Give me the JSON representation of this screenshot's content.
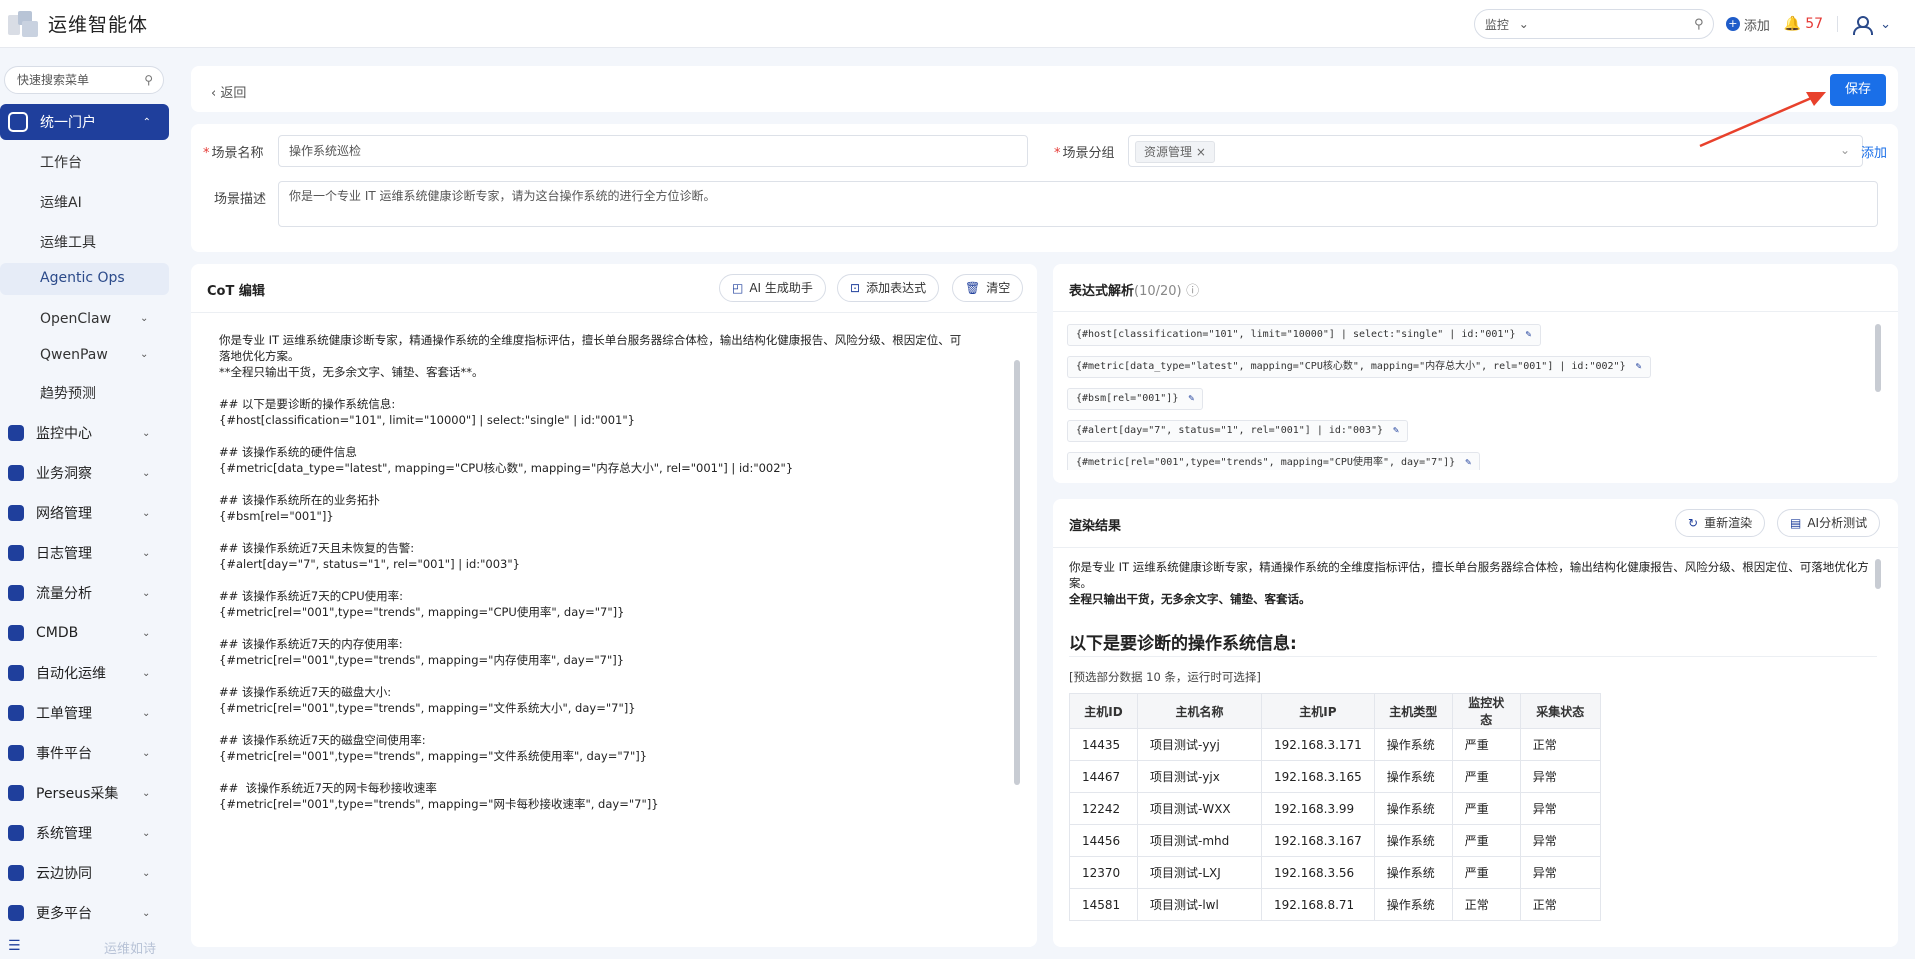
{
  "header": {
    "title": "运维智能体",
    "search_scope": "监控",
    "add_label": "添加",
    "alert_count": "57"
  },
  "sidebar": {
    "search_placeholder": "快速搜索菜单",
    "active_menu": "统一门户",
    "sub_items": [
      "工作台",
      "运维AI",
      "运维工具"
    ],
    "selected_sub": "Agentic Ops",
    "sub_groups": [
      "OpenClaw",
      "QwenPaw"
    ],
    "sub_tail": "趋势预测",
    "menus": [
      "监控中心",
      "业务洞察",
      "网络管理",
      "日志管理",
      "流量分析",
      "CMDB",
      "自动化运维",
      "工单管理",
      "事件平台",
      "Perseus采集",
      "系统管理",
      "云边协同",
      "更多平台"
    ],
    "footer_quote": "运维如诗"
  },
  "topcard": {
    "back_label": "返回",
    "save_label": "保存"
  },
  "form": {
    "name_label": "场景名称",
    "name_value": "操作系统巡检",
    "group_label": "场景分组",
    "group_tag": "资源管理",
    "group_add": "添加",
    "desc_label": "场景描述",
    "desc_value": "你是一个专业 IT 运维系统健康诊断专家，请为这台操作系统的进行全方位诊断。"
  },
  "cot": {
    "title": "CoT 编辑",
    "btn_ai": "AI 生成助手",
    "btn_expr": "添加表达式",
    "btn_clear": "清空",
    "lines": [
      "你是专业 IT 运维系统健康诊断专家，精通操作系统的全维度指标评估，擅长单台服务器综合体检，输出结构化健康报告、风险分级、根因定位、可",
      "落地优化方案。",
      "**全程只输出干货，无多余文字、铺垫、客套话**。",
      "",
      "## 以下是要诊断的操作系统信息:",
      "{#host[classification=\"101\", limit=\"10000\"] | select:\"single\" | id:\"001\"}",
      "",
      "## 该操作系统的硬件信息",
      "{#metric[data_type=\"latest\", mapping=\"CPU核心数\", mapping=\"内存总大小\", rel=\"001\"] | id:\"002\"}",
      "",
      "## 该操作系统所在的业务拓扑",
      "{#bsm[rel=\"001\"]}",
      "",
      "## 该操作系统近7天且未恢复的告警:",
      "{#alert[day=\"7\", status=\"1\", rel=\"001\"] | id:\"003\"}",
      "",
      "## 该操作系统近7天的CPU使用率:",
      "{#metric[rel=\"001\",type=\"trends\", mapping=\"CPU使用率\", day=\"7\"]}",
      "",
      "## 该操作系统近7天的内存使用率:",
      "{#metric[rel=\"001\",type=\"trends\", mapping=\"内存使用率\", day=\"7\"]}",
      "",
      "## 该操作系统近7天的磁盘大小:",
      "{#metric[rel=\"001\",type=\"trends\", mapping=\"文件系统大小\", day=\"7\"]}",
      "",
      "## 该操作系统近7天的磁盘空间使用率:",
      "{#metric[rel=\"001\",type=\"trends\", mapping=\"文件系统使用率\", day=\"7\"]}",
      "",
      "##  该操作系统近7天的网卡每秒接收速率",
      "{#metric[rel=\"001\",type=\"trends\", mapping=\"网卡每秒接收速率\", day=\"7\"]}"
    ]
  },
  "expr": {
    "title": "表达式解析",
    "count": "(10/20)",
    "chips": [
      "{#host[classification=\"101\", limit=\"10000\"] | select:\"single\" | id:\"001\"}",
      "{#metric[data_type=\"latest\", mapping=\"CPU核心数\", mapping=\"内存总大小\", rel=\"001\"] | id:\"002\"}",
      "{#bsm[rel=\"001\"]}",
      "{#alert[day=\"7\", status=\"1\", rel=\"001\"] | id:\"003\"}",
      "{#metric[rel=\"001\",type=\"trends\", mapping=\"CPU使用率\", day=\"7\"]}"
    ]
  },
  "render": {
    "title": "渲染结果",
    "btn_rerender": "重新渲染",
    "btn_ai": "AI分析测试",
    "intro": "你是专业 IT 运维系统健康诊断专家，精通操作系统的全维度指标评估，擅长单台服务器综合体检，输出结构化健康报告、风险分级、根因定位、可落地优化方案。",
    "bold_line": "全程只输出干货，无多余文字、铺垫、客套话。",
    "heading": "以下是要诊断的操作系统信息:",
    "note": "[预选部分数据 10 条，运行时可选择]",
    "columns": [
      "主机ID",
      "主机名称",
      "主机IP",
      "主机类型",
      "监控状态",
      "采集状态"
    ],
    "rows": [
      [
        "14435",
        "项目测试-yyj",
        "192.168.3.171",
        "操作系统",
        "严重",
        "正常"
      ],
      [
        "14467",
        "项目测试-yjx",
        "192.168.3.165",
        "操作系统",
        "严重",
        "异常"
      ],
      [
        "12242",
        "项目测试-WXX",
        "192.168.3.99",
        "操作系统",
        "严重",
        "异常"
      ],
      [
        "14456",
        "项目测试-mhd",
        "192.168.3.167",
        "操作系统",
        "严重",
        "异常"
      ],
      [
        "12370",
        "项目测试-LXJ",
        "192.168.3.56",
        "操作系统",
        "严重",
        "异常"
      ],
      [
        "14581",
        "项目测试-lwl",
        "192.168.8.71",
        "操作系统",
        "正常",
        "正常"
      ]
    ]
  }
}
